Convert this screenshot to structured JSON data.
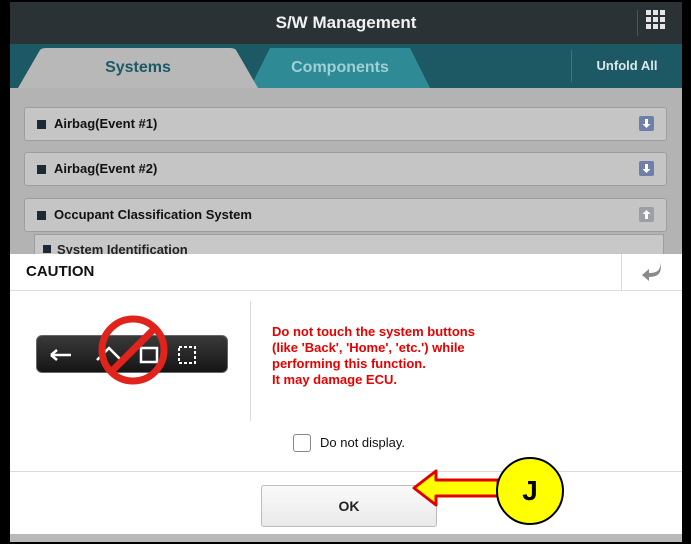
{
  "header": {
    "title": "S/W Management",
    "menu_icon": "grid-icon"
  },
  "tabs": [
    {
      "label": "Systems",
      "active": true
    },
    {
      "label": "Components",
      "active": false
    }
  ],
  "unfold_all": "Unfold All",
  "systems": [
    {
      "label": "Airbag(Event #1)"
    },
    {
      "label": "Airbag(Event #2)"
    },
    {
      "label": "Occupant Classification System"
    }
  ],
  "sub_item": {
    "label": "System Identification"
  },
  "dialog": {
    "title": "CAUTION",
    "back_icon": "back-arrow-icon",
    "warning_lines": [
      "Do not touch the system buttons",
      "(like 'Back', 'Home', 'etc.') while",
      "performing this function.",
      "It may damage ECU."
    ],
    "checkbox_label": "Do not display.",
    "checkbox_checked": false,
    "ok_label": "OK"
  },
  "callout": {
    "label": "J"
  },
  "colors": {
    "titlebar": "#2b3236",
    "tabbar": "#1c5964",
    "active_tab_text": "#1c5964",
    "inactive_tab": "#2e8a95",
    "warning_text": "#e60000",
    "callout": "#ffff00"
  }
}
